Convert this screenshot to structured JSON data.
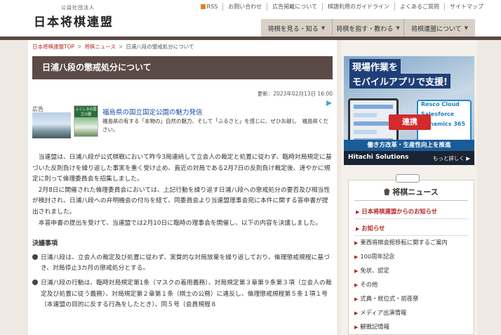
{
  "header": {
    "logo_sub": "公益社団法人",
    "logo_main": "日本将棋連盟",
    "utility_links": [
      "RSS",
      "お問い合わせ",
      "広告掲載について",
      "棋譜利用のガイドライン",
      "よくあるご質問",
      "サイトマップ"
    ],
    "main_nav": [
      "将棋を見る・知る",
      "将棋を指す・教わる",
      "将棋連盟について"
    ]
  },
  "breadcrumb": [
    "日本将棋連盟TOP",
    "将棋ニュース",
    "日浦八段の懲戒処分について"
  ],
  "article": {
    "title": "日浦八段の懲戒処分について",
    "updated": "更新：2023年02月13日 16:00",
    "paragraphs": [
      "当連盟は、日浦八段が公式棋戦において昨今3局連続して立会人の裁定と処置に従わず、臨時対局規定に基づいた反則負けを繰り返した事実を重く受け止め、直近の対局である2月7日の反則負け裁定後、速やかに規定に則って倫理委員会を招集しました。",
      "2月8日に開催された倫理委員会においては、上記行動を繰り返す日浦八段への懲戒処分の要否及び相当性が検討され、日浦八段への弁明機会の付与を経て、同委員会より当連盟理事会宛に本件に関する答申書が提出されました。",
      "本答申書の提出を受けて、当連盟では2月10日に臨時の理事会を開催し、以下の内容を決議しました。"
    ],
    "resolution_heading": "決議事項",
    "resolutions": [
      "日浦八段は、立会人の裁定及び処置に従わず、実質的な対局放棄を繰り返しており、倫理懲戒規程に基づき、対局停止3カ月の懲戒処分とする。",
      "日浦八段の行動は、臨時対局規定第1条（マスクの着用義務）、対局規定第３章第９条第３項（立会人の裁定及び処置に従う義務）、対局規定第２章第１条（棋士の公務）に違反し、倫理懲戒規程第５条１項１号（本連盟の目的に反する行為をしたとき）、同５号（会員規程８"
    ]
  },
  "ad": {
    "label": "広告",
    "title": "福島県の国立国定公園の魅力発信",
    "body": "福島県の有する「本物の」自然の魅力、そして「ふるさと」を感じに、ぜひお越し　福島県ください。",
    "thumb_caption": "ふくしまの国立公園"
  },
  "banner": {
    "line1": "現場作業を",
    "line2": "モバイルアプリで支援!",
    "sync": "連携",
    "product1": "Resco Cloud",
    "product2": "Salesforce",
    "product3": "Dynamics 365",
    "strip": "働き方改革・生産性向上を推進",
    "brand": "Hitachi Solutions",
    "more": "もっと詳しく ▶"
  },
  "news": {
    "heading": "将棋ニュース",
    "items": [
      {
        "label": "日本将棋連盟からのお知らせ",
        "level": "top"
      },
      {
        "label": "お知らせ",
        "level": "top"
      },
      {
        "label": "東西将棋会館移転に関するご案内",
        "level": "sub"
      },
      {
        "label": "100周年記念",
        "level": "sub"
      },
      {
        "label": "免状、認定",
        "level": "sub"
      },
      {
        "label": "その他",
        "level": "sub"
      },
      {
        "label": "式典・就位式・前夜祭",
        "level": "sub"
      },
      {
        "label": "メディア出演情報",
        "level": "sub"
      },
      {
        "label": "観戦記情報",
        "level": "sub"
      }
    ]
  },
  "colors": {
    "accent_red": "#b5261e",
    "title_brown": "#5c4a46",
    "nav_beige": "#d9d0c7",
    "link_blue": "#1a4da8"
  }
}
